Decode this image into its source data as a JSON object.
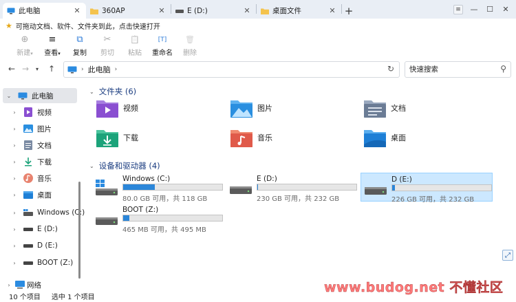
{
  "tabs": [
    {
      "label": "此电脑",
      "icon": "computer-icon",
      "active": true
    },
    {
      "label": "360AP",
      "icon": "folder-icon",
      "active": false
    },
    {
      "label": "E (D:)",
      "icon": "drive-icon",
      "active": false
    },
    {
      "label": "桌面文件",
      "icon": "folder-icon",
      "active": false
    }
  ],
  "window_controls": {
    "settings": "≡",
    "minimize": "—",
    "maximize": "☐",
    "close": "✕"
  },
  "infobar": {
    "text": "可拖动文档、软件、文件夹到此，点击快速打开"
  },
  "toolbar": [
    {
      "label": "新建",
      "icon": "⊕",
      "enabled": false
    },
    {
      "label": "查看",
      "icon": "≡",
      "enabled": true
    },
    {
      "label": "复制",
      "icon": "⧉",
      "enabled": true
    },
    {
      "label": "剪切",
      "icon": "✂",
      "enabled": false
    },
    {
      "label": "粘贴",
      "icon": "📋",
      "enabled": false
    },
    {
      "label": "重命名",
      "icon": "[T]",
      "enabled": true
    },
    {
      "label": "删除",
      "icon": "🗑",
      "enabled": false
    }
  ],
  "address": {
    "crumb": "此电脑",
    "search_placeholder": "快速搜索"
  },
  "nav": [
    {
      "label": "此电脑",
      "icon": "computer",
      "expanded": true,
      "indent": 0,
      "selected": true
    },
    {
      "label": "视频",
      "icon": "video",
      "indent": 1
    },
    {
      "label": "图片",
      "icon": "picture",
      "indent": 1
    },
    {
      "label": "文档",
      "icon": "document",
      "indent": 1
    },
    {
      "label": "下载",
      "icon": "download",
      "indent": 1
    },
    {
      "label": "音乐",
      "icon": "music",
      "indent": 1
    },
    {
      "label": "桌面",
      "icon": "desktop",
      "indent": 1
    },
    {
      "label": "Windows (C:)",
      "icon": "windrive",
      "indent": 1
    },
    {
      "label": "E (D:)",
      "icon": "drive",
      "indent": 1
    },
    {
      "label": "D (E:)",
      "icon": "drive",
      "indent": 1
    },
    {
      "label": "BOOT (Z:)",
      "icon": "drive",
      "indent": 1
    },
    {
      "label": "网络",
      "icon": "network",
      "indent": 0
    }
  ],
  "folders_section": {
    "title": "文件夹 (6)"
  },
  "folders": [
    {
      "label": "视频",
      "color": "#8a4fd1"
    },
    {
      "label": "图片",
      "color": "#2a8fe0"
    },
    {
      "label": "文档",
      "color": "#6b7c95"
    },
    {
      "label": "下载",
      "color": "#1ca37a"
    },
    {
      "label": "音乐",
      "color": "#e05a4a"
    },
    {
      "label": "桌面",
      "color": "#1e7fd6"
    }
  ],
  "drives_section": {
    "title": "设备和驱动器 (4)"
  },
  "drives": [
    {
      "name": "Windows (C:)",
      "info": "80.0 GB 可用，共 118 GB",
      "used_fraction": 0.32,
      "system": true
    },
    {
      "name": "E (D:)",
      "info": "230 GB 可用，共 232 GB",
      "used_fraction": 0.01
    },
    {
      "name": "D (E:)",
      "info": "226 GB 可用，共 232 GB",
      "used_fraction": 0.03,
      "selected": true
    },
    {
      "name": "BOOT (Z:)",
      "info": "465 MB 可用，共 495 MB",
      "used_fraction": 0.06
    }
  ],
  "status": {
    "count": "10 个项目",
    "selected": "选中 1 个项目"
  },
  "watermark": "www.budog.net 不懂社区"
}
